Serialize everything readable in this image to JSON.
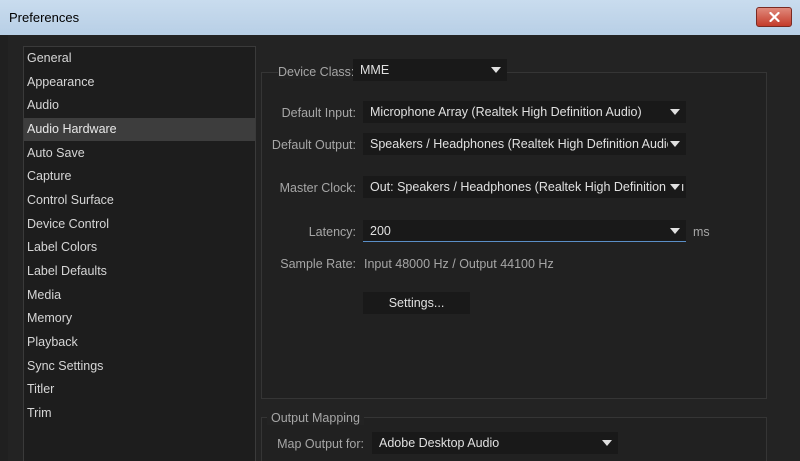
{
  "window": {
    "title": "Preferences"
  },
  "sidebar": {
    "items": [
      {
        "label": "General"
      },
      {
        "label": "Appearance"
      },
      {
        "label": "Audio"
      },
      {
        "label": "Audio Hardware",
        "selected": true
      },
      {
        "label": "Auto Save"
      },
      {
        "label": "Capture"
      },
      {
        "label": "Control Surface"
      },
      {
        "label": "Device Control"
      },
      {
        "label": "Label Colors"
      },
      {
        "label": "Label Defaults"
      },
      {
        "label": "Media"
      },
      {
        "label": "Memory"
      },
      {
        "label": "Playback"
      },
      {
        "label": "Sync Settings"
      },
      {
        "label": "Titler"
      },
      {
        "label": "Trim"
      }
    ]
  },
  "audio_hardware": {
    "device_class_label": "Device Class:",
    "device_class_value": "MME",
    "default_input_label": "Default Input:",
    "default_input_value": "Microphone Array (Realtek High Definition Audio)",
    "default_output_label": "Default Output:",
    "default_output_value": "Speakers / Headphones (Realtek High Definition Audio)",
    "master_clock_label": "Master Clock:",
    "master_clock_value": "Out: Speakers / Headphones (Realtek High Definition Au",
    "latency_label": "Latency:",
    "latency_value": "200",
    "latency_unit": "ms",
    "sample_rate_label": "Sample Rate:",
    "sample_rate_value": "Input 48000 Hz / Output 44100 Hz",
    "settings_button": "Settings..."
  },
  "output_mapping": {
    "legend": "Output Mapping",
    "map_output_label": "Map Output for:",
    "map_output_value": "Adobe Desktop Audio"
  },
  "colors": {
    "accent": "#5b8fc7",
    "titlebar": "#c3d7ec",
    "close_button": "#c7402f",
    "panel": "#232323"
  },
  "icons": {
    "close": "close-icon",
    "caret": "chevron-down-icon"
  }
}
